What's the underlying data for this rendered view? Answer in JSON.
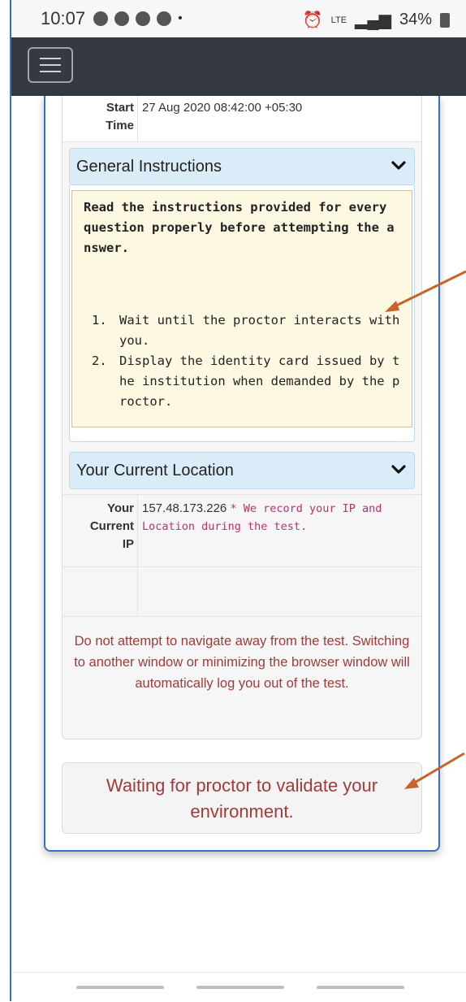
{
  "status_bar": {
    "time": "10:07",
    "network": "LTE",
    "battery": "34%"
  },
  "test_info": {
    "start_label": "Start Time",
    "start_label_line1": "Start",
    "start_label_line2": "Time",
    "start_value": "27 Aug 2020 08:42:00 +05:30"
  },
  "general_instructions": {
    "header": "General Instructions",
    "intro": "Read the instructions provided for every question properly before attempting the answer.",
    "items": [
      "Wait until the proctor interacts with you.",
      "Display the identity card issued by the institution when demanded by the proctor."
    ]
  },
  "location": {
    "header": "Your Current Location",
    "ip_label_line1": "Your",
    "ip_label_line2": "Current",
    "ip_label_line3": "IP",
    "ip_value": "157.48.173.226",
    "ip_note": "* We record your IP and Location during the test."
  },
  "warning": "Do not attempt to navigate away from the test. Switching to another window or minimizing the browser window will automatically log you out of the test.",
  "waiting_message": "Waiting for proctor to validate your environment.",
  "colors": {
    "navbar": "#343a40",
    "accordion": "#d9ecf7",
    "instructions_bg": "#fdf8e1",
    "warning_text": "#a33a3a",
    "arrow": "#c8642a"
  },
  "icons": {
    "menu": "hamburger-icon",
    "chevron": "chevron-down-icon"
  }
}
